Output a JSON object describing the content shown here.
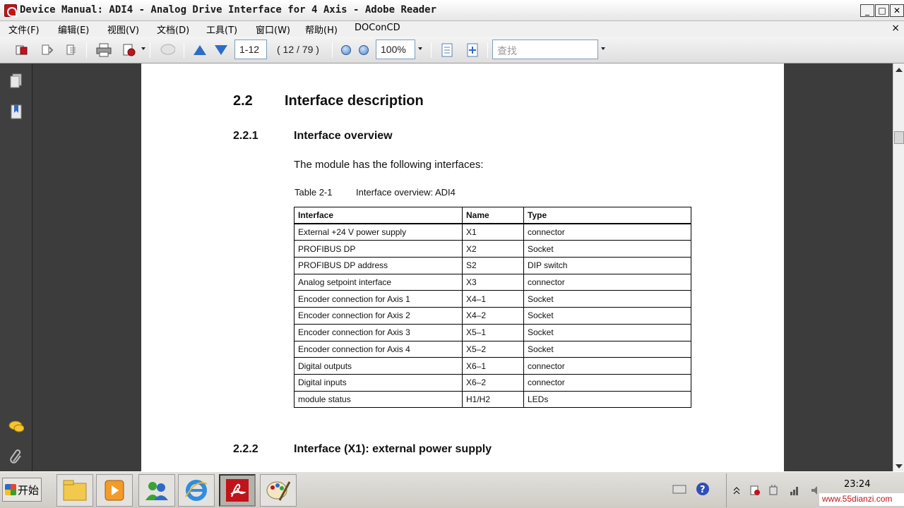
{
  "window": {
    "title": "Device Manual: ADI4 - Analog Drive Interface for 4 Axis - Adobe Reader",
    "minimize_glyph": "_",
    "maximize_glyph": "□",
    "close_glyph": "✕"
  },
  "menu": {
    "items": [
      "文件(F)",
      "编辑(E)",
      "视图(V)",
      "文档(D)",
      "工具(T)",
      "窗口(W)",
      "帮助(H)",
      "DOConCD"
    ],
    "doc_close": "×"
  },
  "toolbar": {
    "page_input": "1-12",
    "page_count": "( 12 / 79 )",
    "zoom_input": "100%",
    "search_placeholder": "查找"
  },
  "page": {
    "section_number": "2.2",
    "section_title": "Interface description",
    "subsection1_number": "2.2.1",
    "subsection1_title": "Interface overview",
    "intro_text": "The module has the following interfaces:",
    "table_caption_number": "Table 2-1",
    "table_caption_text": "Interface overview: ADI4",
    "table": {
      "headers": [
        "Interface",
        "Name",
        "Type"
      ],
      "rows": [
        [
          "External +24 V power supply",
          "X1",
          "connector"
        ],
        [
          "PROFIBUS DP",
          "X2",
          "Socket"
        ],
        [
          "PROFIBUS DP address",
          "S2",
          "DIP switch"
        ],
        [
          "Analog setpoint interface",
          "X3",
          "connector"
        ],
        [
          "Encoder connection for Axis 1",
          "X4–1",
          "Socket"
        ],
        [
          "Encoder connection for Axis 2",
          "X4–2",
          "Socket"
        ],
        [
          "Encoder connection for Axis 3",
          "X5–1",
          "Socket"
        ],
        [
          "Encoder connection for Axis 4",
          "X5–2",
          "Socket"
        ],
        [
          "Digital outputs",
          "X6–1",
          "connector"
        ],
        [
          "Digital inputs",
          "X6–2",
          "connector"
        ],
        [
          "module status",
          "H1/H2",
          "LEDs"
        ]
      ]
    },
    "subsection2_number": "2.2.2",
    "subsection2_title": "Interface (X1): external power supply"
  },
  "taskbar": {
    "start_label": "开始",
    "clock": "23:24",
    "watermark": "www.55dianzi.com"
  },
  "colors": {
    "acrobat_red": "#c0141a",
    "nav_blue": "#2e6bc6",
    "panel_dark": "#3c3c3c"
  }
}
